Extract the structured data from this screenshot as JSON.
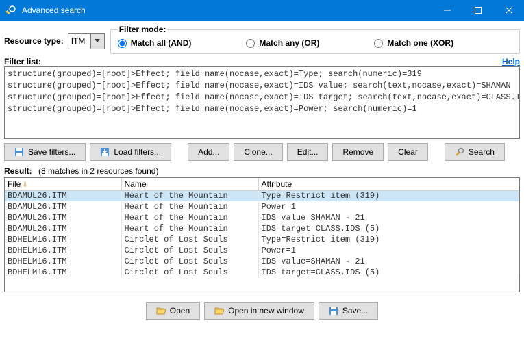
{
  "window": {
    "title": "Advanced search"
  },
  "resourceType": {
    "label": "Resource type:",
    "value": "ITM"
  },
  "filterMode": {
    "legend": "Filter mode:",
    "options": [
      "Match all (AND)",
      "Match any (OR)",
      "Match one (XOR)"
    ],
    "selected": 0
  },
  "filterList": {
    "label": "Filter list:",
    "help": "Help",
    "items": [
      "structure(grouped)=[root]>Effect; field name(nocase,exact)=Type; search(numeric)=319",
      "structure(grouped)=[root]>Effect; field name(nocase,exact)=IDS value; search(text,nocase,exact)=SHAMAN",
      "structure(grouped)=[root]>Effect; field name(nocase,exact)=IDS target; search(text,nocase,exact)=CLASS.IDS",
      "structure(grouped)=[root]>Effect; field name(nocase,exact)=Power; search(numeric)=1"
    ]
  },
  "buttons": {
    "saveFilters": "Save filters...",
    "loadFilters": "Load filters...",
    "add": "Add...",
    "clone": "Clone...",
    "edit": "Edit...",
    "remove": "Remove",
    "clear": "Clear",
    "search": "Search",
    "open": "Open",
    "openNew": "Open in new window",
    "save": "Save..."
  },
  "results": {
    "label": "Result:",
    "count": "(8 matches in 2 resources found)",
    "headers": {
      "file": "File",
      "name": "Name",
      "attribute": "Attribute"
    },
    "rows": [
      {
        "file": "BDAMUL26.ITM",
        "name": "Heart of the Mountain",
        "attr": "Type=Restrict item (319)",
        "selected": true
      },
      {
        "file": "BDAMUL26.ITM",
        "name": "Heart of the Mountain",
        "attr": "Power=1"
      },
      {
        "file": "BDAMUL26.ITM",
        "name": "Heart of the Mountain",
        "attr": "IDS value=SHAMAN - 21"
      },
      {
        "file": "BDAMUL26.ITM",
        "name": "Heart of the Mountain",
        "attr": "IDS target=CLASS.IDS (5)"
      },
      {
        "file": "BDHELM16.ITM",
        "name": "Circlet of Lost Souls",
        "attr": "Type=Restrict item (319)"
      },
      {
        "file": "BDHELM16.ITM",
        "name": "Circlet of Lost Souls",
        "attr": "Power=1"
      },
      {
        "file": "BDHELM16.ITM",
        "name": "Circlet of Lost Souls",
        "attr": "IDS value=SHAMAN - 21"
      },
      {
        "file": "BDHELM16.ITM",
        "name": "Circlet of Lost Souls",
        "attr": "IDS target=CLASS.IDS (5)"
      }
    ]
  }
}
